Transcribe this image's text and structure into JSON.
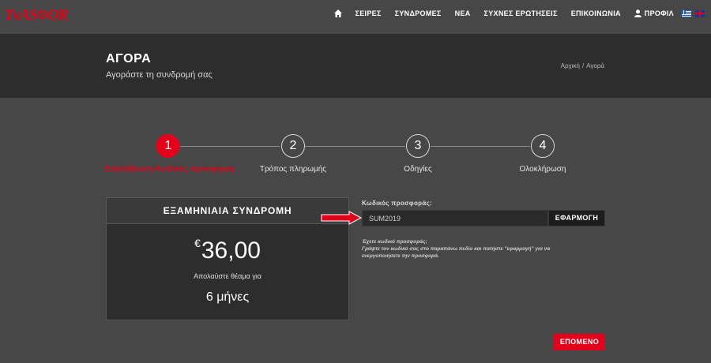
{
  "brand": {
    "logo_left": "TvAS",
    "logo_right": "OR",
    "accent": "#e3001b"
  },
  "nav": {
    "items": [
      "ΣΕΙΡΕΣ",
      "ΣΥΝΔΡΟΜΕΣ",
      "ΝΕΑ",
      "ΣΥΧΝΕΣ ΕΡΩΤΗΣΕΙΣ",
      "ΕΠΙΚΟΙΝΩΝΙΑ"
    ],
    "profile": "ΠΡΟΦΙΛ",
    "icons": [
      "home-icon",
      "user-icon",
      "greek-flag-icon",
      "uk-flag-icon"
    ]
  },
  "header": {
    "title": "ΑΓΟΡΑ",
    "subtitle": "Αγοράστε τη συνδρομή σας",
    "breadcrumb": [
      "Αρχική",
      "/",
      "Αγορά"
    ]
  },
  "steps": [
    {
      "number": "1",
      "label": "Επαλήθευση-Κωδικός προσφοράς",
      "active": true
    },
    {
      "number": "2",
      "label": "Τρόπος πληρωμής",
      "active": false
    },
    {
      "number": "3",
      "label": "Οδηγίες",
      "active": false
    },
    {
      "number": "4",
      "label": "Ολοκλήρωση",
      "active": false
    }
  ],
  "plan": {
    "title": "ΕΞΑΜΗΝΙΑΙΑ ΣΥΝΔΡΟΜΗ",
    "currency": "€",
    "price": "36,00",
    "enjoy": "Απολαύστε θέαμα για",
    "duration": "6 μήνες"
  },
  "promo": {
    "label": "Κωδικός προσφοράς:",
    "value": "SUM2019",
    "apply": "ΕΦΑΡΜΟΓΗ",
    "help_line1": "Έχετε κωδικό προσφοράς;",
    "help_line2": "Γράψτε τον κωδικό σας στο παραπάνω πεδίο και πατήστε \"εφαρμογή\" για να",
    "help_line3": "ενεργοποιήσετε την προσφορά."
  },
  "actions": {
    "next": "ΕΠΟΜΕΝΟ"
  }
}
